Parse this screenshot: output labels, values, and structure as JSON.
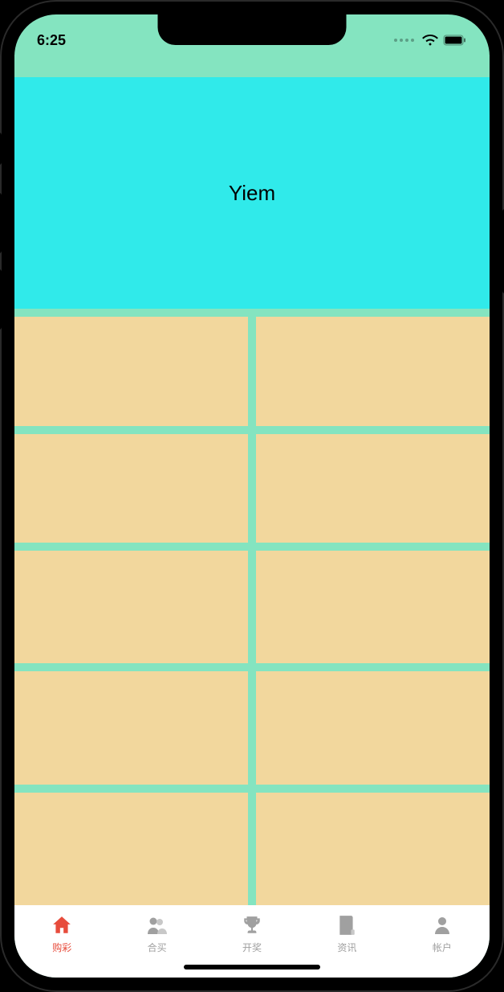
{
  "status": {
    "time": "6:25"
  },
  "hero": {
    "title": "Yiem"
  },
  "tabs": [
    {
      "id": "lottery",
      "label": "购彩",
      "active": true,
      "icon": "home"
    },
    {
      "id": "group",
      "label": "合买",
      "active": false,
      "icon": "group"
    },
    {
      "id": "results",
      "label": "开奖",
      "active": false,
      "icon": "trophy"
    },
    {
      "id": "news",
      "label": "资讯",
      "active": false,
      "icon": "document"
    },
    {
      "id": "account",
      "label": "帐户",
      "active": false,
      "icon": "person"
    }
  ],
  "colors": {
    "screen_bg": "#84e4c0",
    "hero_bg": "#30eaea",
    "cell_bg": "#f2d79d",
    "active": "#e74c3c",
    "inactive": "#a0a0a0"
  },
  "grid": {
    "rows": 5,
    "cols": 2
  }
}
